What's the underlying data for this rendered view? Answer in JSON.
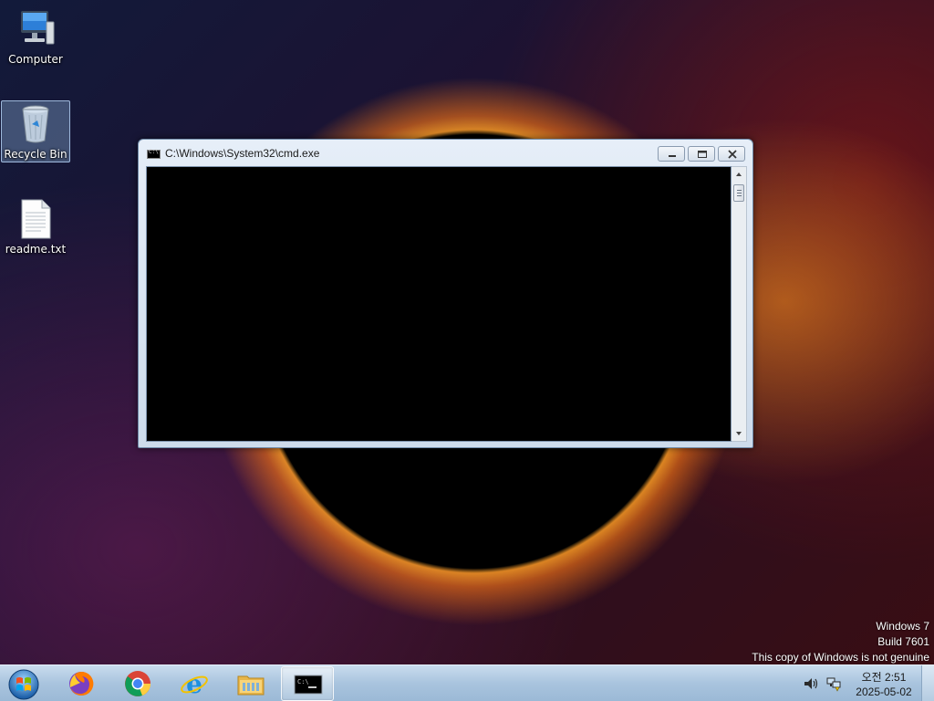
{
  "desktop": {
    "icons": [
      {
        "label": "Computer",
        "icon": "computer-icon"
      },
      {
        "label": "Recycle Bin",
        "icon": "recycle-bin-icon"
      },
      {
        "label": "readme.txt",
        "icon": "text-file-icon"
      }
    ]
  },
  "window": {
    "title": "C:\\Windows\\System32\\cmd.exe",
    "console_text": ""
  },
  "watermark": {
    "line1": "Windows 7",
    "line2": "Build 7601",
    "line3": "This copy of Windows is not genuine"
  },
  "taskbar": {
    "items": [
      {
        "name": "firefox-icon"
      },
      {
        "name": "chrome-icon"
      },
      {
        "name": "internet-explorer-icon"
      },
      {
        "name": "file-explorer-icon"
      },
      {
        "name": "cmd-icon",
        "active": true
      }
    ],
    "clock": {
      "time": "오전 2:51",
      "date": "2025-05-02"
    }
  },
  "colors": {
    "console_bg": "#000000",
    "taskbar": "#a9c4de"
  }
}
